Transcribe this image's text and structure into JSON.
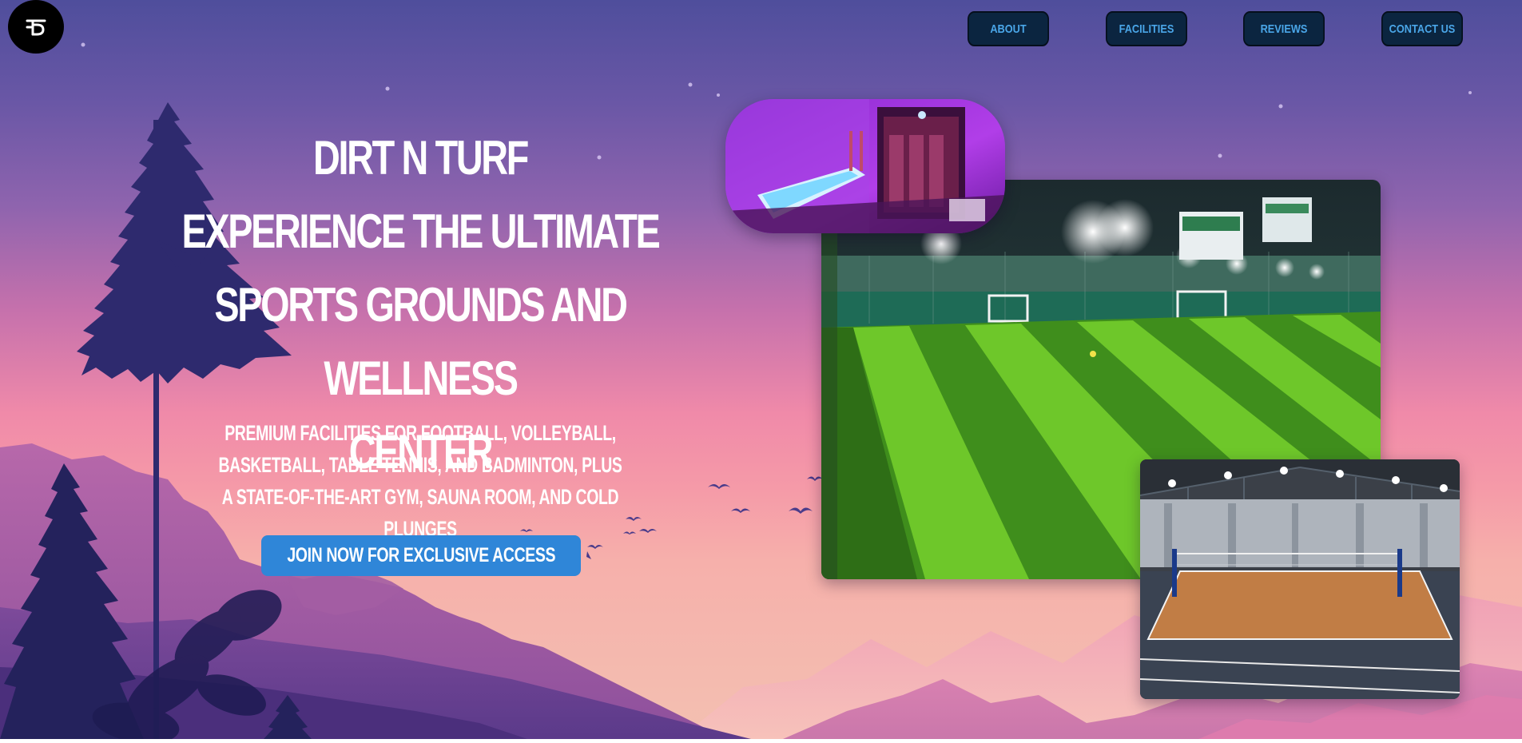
{
  "header": {
    "logo_icon": "dt-monogram-icon",
    "nav": [
      {
        "label": "ABOUT"
      },
      {
        "label": "FACILITIES"
      },
      {
        "label": "REVIEWS"
      },
      {
        "label": "CONTACT US"
      }
    ]
  },
  "hero": {
    "title_lines": [
      "DIRT N TURF",
      "EXPERIENCE THE ULTIMATE",
      "SPORTS GROUNDS AND WELLNESS",
      "CENTER"
    ],
    "subtitle": "PREMIUM FACILITIES FOR FOOTBALL, VOLLEYBALL, BASKETBALL, TABLE TENNIS, AND BADMINTON, PLUS A STATE-OF-THE-ART GYM, SAUNA ROOM, AND COLD PLUNGES",
    "cta_label": "JOIN NOW FOR EXCLUSIVE ACCESS"
  },
  "images": [
    {
      "name": "sauna-room-photo"
    },
    {
      "name": "turf-football-field-photo"
    },
    {
      "name": "indoor-volleyball-court-photo"
    }
  ],
  "colors": {
    "sky_top": "#4f4e9c",
    "sky_mid": "#f08aa9",
    "nav_bg": "#0b2540",
    "nav_text": "#4aa6e8",
    "cta_bg": "#2f86d8",
    "text": "#ffffff"
  }
}
